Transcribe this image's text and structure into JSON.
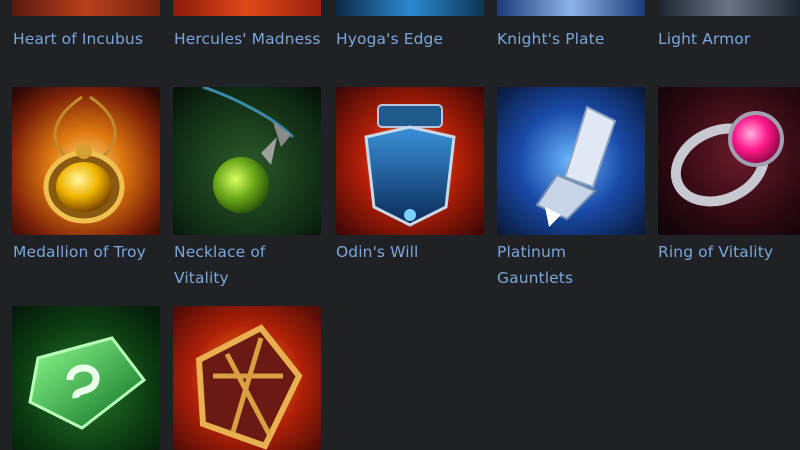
{
  "items": [
    {
      "label": "Heart of Incubus",
      "icon": "incubus-heart-icon"
    },
    {
      "label": "Hercules' Madness",
      "icon": "hercules-madness-icon"
    },
    {
      "label": "Hyoga's Edge",
      "icon": "hyoga-edge-icon"
    },
    {
      "label": "Knight's Plate",
      "icon": "knight-plate-icon"
    },
    {
      "label": "Light Armor",
      "icon": "light-armor-icon"
    },
    {
      "label": "Medallion of Troy",
      "icon": "medallion-icon"
    },
    {
      "label": "Necklace of Vitality",
      "icon": "green-orb-necklace-icon"
    },
    {
      "label": "Odin's Will",
      "icon": "odin-armor-icon"
    },
    {
      "label": "Platinum Gauntlets",
      "icon": "gauntlet-icon"
    },
    {
      "label": "Ring of Vitality",
      "icon": "ruby-ring-icon"
    },
    {
      "label": "",
      "icon": "green-gem-icon"
    },
    {
      "label": "",
      "icon": "golden-shield-icon"
    }
  ],
  "colors": {
    "background": "#202124",
    "label": "#78a7dc"
  }
}
